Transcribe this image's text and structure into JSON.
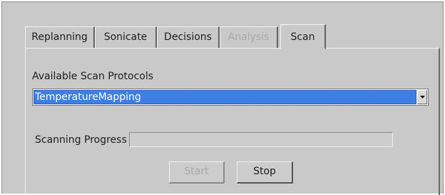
{
  "tabs": [
    {
      "label": "Replanning",
      "state": "normal"
    },
    {
      "label": "Sonicate",
      "state": "normal"
    },
    {
      "label": "Decisions",
      "state": "normal"
    },
    {
      "label": "Analysis",
      "state": "disabled"
    },
    {
      "label": "Scan",
      "state": "selected"
    }
  ],
  "scan": {
    "protocols_label": "Available Scan Protocols",
    "selected_protocol": "TemperatureMapping",
    "progress_label": "Scanning Progress",
    "progress_fraction": 0,
    "start_label": "Start",
    "start_enabled": false,
    "stop_label": "Stop",
    "stop_enabled": true
  },
  "icons": {
    "dropdown": "chevron-down-icon"
  },
  "colors": {
    "selection": "#3d7fe4",
    "window_background": "#c9c9c9",
    "disabled_text": "#a9a9a9"
  }
}
